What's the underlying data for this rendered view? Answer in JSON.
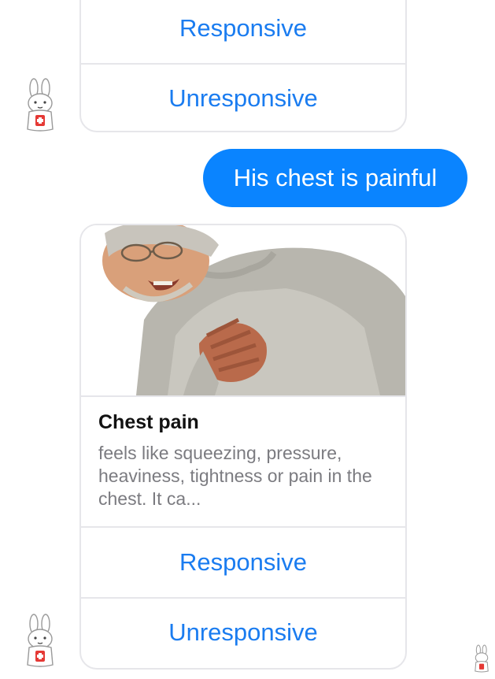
{
  "conversation": {
    "top_card": {
      "buttons": [
        {
          "label": "Responsive"
        },
        {
          "label": "Unresponsive"
        }
      ]
    },
    "user_message": {
      "text": "His chest is painful"
    },
    "main_card": {
      "title": "Chest pain",
      "subtitle": "feels like squeezing, pressure, heaviness, tightness or pain in the chest. It ca...",
      "buttons": [
        {
          "label": "Responsive"
        },
        {
          "label": "Unresponsive"
        }
      ]
    }
  },
  "icons": {
    "bot_avatar": "rabbit-doctor-icon",
    "read_receipt": "rabbit-doctor-icon"
  },
  "colors": {
    "accent": "#1a7cf0",
    "user_bubble": "#0a84ff",
    "card_border": "#e6e6ea",
    "subtitle_text": "#7b7b80"
  }
}
